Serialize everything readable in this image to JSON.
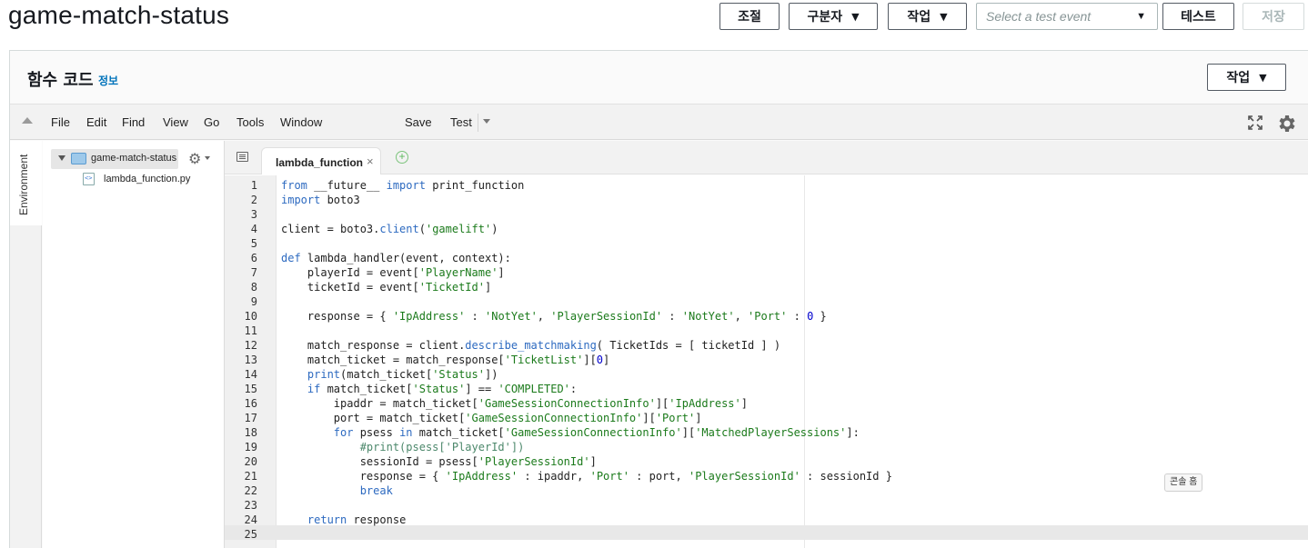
{
  "page": {
    "title": "game-match-status"
  },
  "top_actions": {
    "throttle": "조절",
    "qualifier": "구분자",
    "actions": "작업",
    "test_event_placeholder": "Select a test event",
    "test": "테스트",
    "save": "저장"
  },
  "panel": {
    "title": "함수 코드",
    "info": "정보",
    "actions": "작업"
  },
  "menu": {
    "items": [
      "File",
      "Edit",
      "Find",
      "View",
      "Go",
      "Tools",
      "Window",
      "Save",
      "Test"
    ]
  },
  "sidebar": {
    "environment_label": "Environment"
  },
  "tree": {
    "root": "game-match-status",
    "file": "lambda_function.py"
  },
  "editor": {
    "tab_label": "lambda_function",
    "lines": [
      "from __future__ import print_function",
      "import boto3",
      "",
      "client = boto3.client('gamelift')",
      "",
      "def lambda_handler(event, context):",
      "    playerId = event['PlayerName']",
      "    ticketId = event['TicketId']",
      "",
      "    response = { 'IpAddress' : 'NotYet', 'PlayerSessionId' : 'NotYet', 'Port' : 0 }",
      "",
      "    match_response = client.describe_matchmaking( TicketIds = [ ticketId ] )",
      "    match_ticket = match_response['TicketList'][0]",
      "    print(match_ticket['Status'])",
      "    if match_ticket['Status'] == 'COMPLETED':",
      "        ipaddr = match_ticket['GameSessionConnectionInfo']['IpAddress']",
      "        port = match_ticket['GameSessionConnectionInfo']['Port']",
      "        for psess in match_ticket['GameSessionConnectionInfo']['MatchedPlayerSessions']:",
      "            #print(psess['PlayerId'])",
      "            sessionId = psess['PlayerSessionId']",
      "            response = { 'IpAddress' : ipaddr, 'Port' : port, 'PlayerSessionId' : sessionId }",
      "            break",
      "",
      "    return response",
      ""
    ]
  },
  "tooltip": "콘솔 홈"
}
